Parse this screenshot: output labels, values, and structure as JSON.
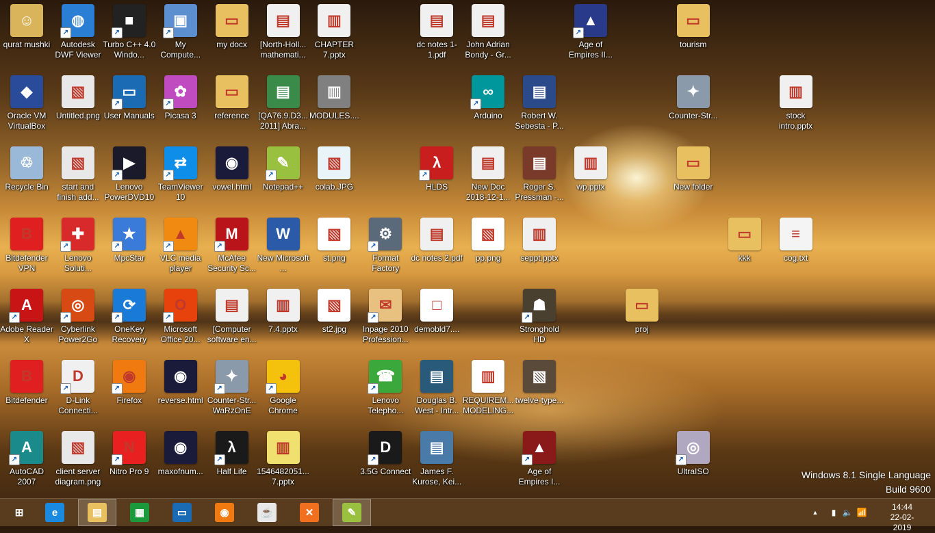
{
  "os": {
    "watermark_line1": "Windows 8.1 Single Language",
    "watermark_line2": "Build 9600"
  },
  "desktop_icons": [
    {
      "label": "qurat mushki",
      "icon": "user-folder-icon",
      "color": "#d9b45a",
      "col": 0,
      "row": 0,
      "shortcut": false
    },
    {
      "label": "Autodesk DWF Viewer",
      "icon": "globe-icon",
      "color": "#2a7fd4",
      "col": 1,
      "row": 0,
      "shortcut": true
    },
    {
      "label": "Turbo C++ 4.0 Windo...",
      "icon": "apple-icon",
      "color": "#222222",
      "col": 2,
      "row": 0,
      "shortcut": true
    },
    {
      "label": "My Compute...",
      "icon": "computer-icon",
      "color": "#5b8fd0",
      "col": 3,
      "row": 0,
      "shortcut": true
    },
    {
      "label": "my docx",
      "icon": "folder-icon",
      "color": "#e8c060",
      "col": 4,
      "row": 0,
      "shortcut": false
    },
    {
      "label": "[North-Holl... mathemati...",
      "icon": "pdf-icon",
      "color": "#f0f0f0",
      "col": 5,
      "row": 0,
      "shortcut": false
    },
    {
      "label": "CHAPTER 7.pptx",
      "icon": "pptx-icon",
      "color": "#f0f0f0",
      "col": 6,
      "row": 0,
      "shortcut": false
    },
    {
      "label": "dc notes 1-1.pdf",
      "icon": "pdf-icon",
      "color": "#f0f0f0",
      "col": 8,
      "row": 0,
      "shortcut": false
    },
    {
      "label": "John Adrian Bondy - Gr...",
      "icon": "pdf-icon",
      "color": "#f0f0f0",
      "col": 9,
      "row": 0,
      "shortcut": false
    },
    {
      "label": "Age of Empires II...",
      "icon": "helmet-icon",
      "color": "#2a3a8a",
      "col": 11,
      "row": 0,
      "shortcut": true
    },
    {
      "label": "tourism",
      "icon": "folder-icon",
      "color": "#e8c060",
      "col": 13,
      "row": 0,
      "shortcut": false
    },
    {
      "label": "Oracle VM VirtualBox",
      "icon": "cube-icon",
      "color": "#2a4a9a",
      "col": 0,
      "row": 1,
      "shortcut": false
    },
    {
      "label": "Untitled.png",
      "icon": "image-icon",
      "color": "#e8e8e8",
      "col": 1,
      "row": 1,
      "shortcut": false
    },
    {
      "label": "User Manuals",
      "icon": "lenovo-icon",
      "color": "#1a6ab4",
      "col": 2,
      "row": 1,
      "shortcut": true
    },
    {
      "label": "Picasa 3",
      "icon": "picasa-icon",
      "color": "#c04ac0",
      "col": 3,
      "row": 1,
      "shortcut": true
    },
    {
      "label": "reference",
      "icon": "folder-icon",
      "color": "#e8c060",
      "col": 4,
      "row": 1,
      "shortcut": false
    },
    {
      "label": "[QA76.9.D3... 2011] Abra...",
      "icon": "pdf-icon",
      "color": "#3a8a4a",
      "col": 5,
      "row": 1,
      "shortcut": false
    },
    {
      "label": "MODULES....",
      "icon": "pptx-icon",
      "color": "#808080",
      "col": 6,
      "row": 1,
      "shortcut": false
    },
    {
      "label": "Arduino",
      "icon": "arduino-icon",
      "color": "#00979c",
      "col": 9,
      "row": 1,
      "shortcut": true
    },
    {
      "label": "Robert W. Sebesta - P...",
      "icon": "pdf-icon",
      "color": "#2a4a8a",
      "col": 10,
      "row": 1,
      "shortcut": false
    },
    {
      "label": "Counter-Str...",
      "icon": "cs-icon",
      "color": "#8a9aaa",
      "col": 13,
      "row": 1,
      "shortcut": false
    },
    {
      "label": "stock intro.pptx",
      "icon": "pptx-icon",
      "color": "#f0f0f0",
      "col": 15,
      "row": 1,
      "shortcut": false
    },
    {
      "label": "Recycle Bin",
      "icon": "recycle-bin-icon",
      "color": "#9ab8d8",
      "col": 0,
      "row": 2,
      "shortcut": false
    },
    {
      "label": "start and finish add...",
      "icon": "image-icon",
      "color": "#e8e8e8",
      "col": 1,
      "row": 2,
      "shortcut": false
    },
    {
      "label": "Lenovo PowerDVD10",
      "icon": "play-icon",
      "color": "#1a1a2a",
      "col": 2,
      "row": 2,
      "shortcut": true
    },
    {
      "label": "TeamViewer 10",
      "icon": "teamviewer-icon",
      "color": "#0e8ee9",
      "col": 3,
      "row": 2,
      "shortcut": true
    },
    {
      "label": "vowel.html",
      "icon": "firefox-icon",
      "color": "#1a1a3a",
      "col": 4,
      "row": 2,
      "shortcut": false
    },
    {
      "label": "Notepad++",
      "icon": "notepadpp-icon",
      "color": "#9ac040",
      "col": 5,
      "row": 2,
      "shortcut": true
    },
    {
      "label": "colab.JPG",
      "icon": "image-icon",
      "color": "#e8f4f8",
      "col": 6,
      "row": 2,
      "shortcut": false
    },
    {
      "label": "HLDS",
      "icon": "halflife-icon",
      "color": "#c81e1e",
      "col": 8,
      "row": 2,
      "shortcut": true
    },
    {
      "label": "New Doc 2018-12-1...",
      "icon": "pdf-icon",
      "color": "#f0f0f0",
      "col": 9,
      "row": 2,
      "shortcut": false
    },
    {
      "label": "Roger S. Pressman -...",
      "icon": "pdf-icon",
      "color": "#7a3a2a",
      "col": 10,
      "row": 2,
      "shortcut": false
    },
    {
      "label": "wp.pptx",
      "icon": "pptx-icon",
      "color": "#f0f0f0",
      "col": 11,
      "row": 2,
      "shortcut": false
    },
    {
      "label": "New folder",
      "icon": "folder-icon",
      "color": "#e8c060",
      "col": 13,
      "row": 2,
      "shortcut": false
    },
    {
      "label": "Bitdefender VPN",
      "icon": "bitdefender-vpn-icon",
      "color": "#e02020",
      "col": 0,
      "row": 3,
      "shortcut": false
    },
    {
      "label": "Lenovo Soluti...",
      "icon": "lenovo-solutions-icon",
      "color": "#d82a2a",
      "col": 1,
      "row": 3,
      "shortcut": true
    },
    {
      "label": "MpcStar",
      "icon": "star-icon",
      "color": "#3a7ad8",
      "col": 2,
      "row": 3,
      "shortcut": true
    },
    {
      "label": "VLC media player",
      "icon": "vlc-icon",
      "color": "#f08a10",
      "col": 3,
      "row": 3,
      "shortcut": true
    },
    {
      "label": "McAfee Security Sc...",
      "icon": "mcafee-icon",
      "color": "#b8141a",
      "col": 4,
      "row": 3,
      "shortcut": true
    },
    {
      "label": "New Microsoft ...",
      "icon": "word-icon",
      "color": "#2a5aa8",
      "col": 5,
      "row": 3,
      "shortcut": false
    },
    {
      "label": "st.png",
      "icon": "image-icon",
      "color": "#ffffff",
      "col": 6,
      "row": 3,
      "shortcut": false
    },
    {
      "label": "Format Factory",
      "icon": "format-factory-icon",
      "color": "#5a6a7a",
      "col": 7,
      "row": 3,
      "shortcut": true
    },
    {
      "label": "dc notes 2.pdf",
      "icon": "pdf-icon",
      "color": "#f0f0f0",
      "col": 8,
      "row": 3,
      "shortcut": false
    },
    {
      "label": "pp.png",
      "icon": "image-icon",
      "color": "#ffffff",
      "col": 9,
      "row": 3,
      "shortcut": false
    },
    {
      "label": "seppt.pptx",
      "icon": "pptx-icon",
      "color": "#f0f0f0",
      "col": 10,
      "row": 3,
      "shortcut": false
    },
    {
      "label": "kkk",
      "icon": "folder-icon",
      "color": "#e8c060",
      "col": 14,
      "row": 3,
      "shortcut": false
    },
    {
      "label": "cog.txt",
      "icon": "text-file-icon",
      "color": "#f4f4f4",
      "col": 15,
      "row": 3,
      "shortcut": false
    },
    {
      "label": "Adobe Reader X",
      "icon": "adobe-reader-icon",
      "color": "#c81414",
      "col": 0,
      "row": 4,
      "shortcut": true
    },
    {
      "label": "Cyberlink Power2Go",
      "icon": "disc-flame-icon",
      "color": "#d84a14",
      "col": 1,
      "row": 4,
      "shortcut": true
    },
    {
      "label": "OneKey Recovery",
      "icon": "onekey-icon",
      "color": "#1a7ad8",
      "col": 2,
      "row": 4,
      "shortcut": true
    },
    {
      "label": "Microsoft Office 20...",
      "icon": "office-icon",
      "color": "#e8420c",
      "col": 3,
      "row": 4,
      "shortcut": true
    },
    {
      "label": "[Computer software en...",
      "icon": "pdf-icon",
      "color": "#f0f0f0",
      "col": 4,
      "row": 4,
      "shortcut": false
    },
    {
      "label": "7.4.pptx",
      "icon": "pptx-icon",
      "color": "#f0f0f0",
      "col": 5,
      "row": 4,
      "shortcut": false
    },
    {
      "label": "st2.jpg",
      "icon": "image-icon",
      "color": "#ffffff",
      "col": 6,
      "row": 4,
      "shortcut": false
    },
    {
      "label": "Inpage 2010 Profession...",
      "icon": "inpage-icon",
      "color": "#e8c080",
      "col": 7,
      "row": 4,
      "shortcut": true
    },
    {
      "label": "demobld7....",
      "icon": "blank-file-icon",
      "color": "#ffffff",
      "col": 8,
      "row": 4,
      "shortcut": false
    },
    {
      "label": "Stronghold HD",
      "icon": "stronghold-icon",
      "color": "#4a4030",
      "col": 10,
      "row": 4,
      "shortcut": true
    },
    {
      "label": "proj",
      "icon": "folder-icon",
      "color": "#e8c060",
      "col": 12,
      "row": 4,
      "shortcut": false
    },
    {
      "label": "Bitdefender",
      "icon": "bitdefender-icon",
      "color": "#e02020",
      "col": 0,
      "row": 5,
      "shortcut": false
    },
    {
      "label": "D-Link Connecti...",
      "icon": "dlink-icon",
      "color": "#f0f0f0",
      "col": 1,
      "row": 5,
      "shortcut": true
    },
    {
      "label": "Firefox",
      "icon": "firefox-icon",
      "color": "#f07a10",
      "col": 2,
      "row": 5,
      "shortcut": true
    },
    {
      "label": "reverse.html",
      "icon": "firefox-icon",
      "color": "#1a1a3a",
      "col": 3,
      "row": 5,
      "shortcut": false
    },
    {
      "label": "Counter-Str... WaRzOnE",
      "icon": "cs-icon",
      "color": "#8a9aaa",
      "col": 4,
      "row": 5,
      "shortcut": true
    },
    {
      "label": "Google Chrome",
      "icon": "chrome-icon",
      "color": "#f4c20d",
      "col": 5,
      "row": 5,
      "shortcut": true
    },
    {
      "label": "Lenovo Telepho...",
      "icon": "free-call-icon",
      "color": "#3aa83a",
      "col": 7,
      "row": 5,
      "shortcut": true
    },
    {
      "label": "Douglas B. West - Intr...",
      "icon": "pdf-icon",
      "color": "#2a5a7a",
      "col": 8,
      "row": 5,
      "shortcut": false
    },
    {
      "label": "REQUIREM... MODELING...",
      "icon": "pptx-icon",
      "color": "#ffffff",
      "col": 9,
      "row": 5,
      "shortcut": false
    },
    {
      "label": "twelve-type...",
      "icon": "image-icon",
      "color": "#5a4a3a",
      "col": 10,
      "row": 5,
      "shortcut": false
    },
    {
      "label": "AutoCAD 2007",
      "icon": "autocad-icon",
      "color": "#1a8a8a",
      "col": 0,
      "row": 6,
      "shortcut": true
    },
    {
      "label": "client server diagram.png",
      "icon": "image-icon",
      "color": "#e8e8e8",
      "col": 1,
      "row": 6,
      "shortcut": false
    },
    {
      "label": "Nitro Pro 9",
      "icon": "nitro-icon",
      "color": "#e82020",
      "col": 2,
      "row": 6,
      "shortcut": true
    },
    {
      "label": "maxofnum...",
      "icon": "firefox-icon",
      "color": "#1a1a3a",
      "col": 3,
      "row": 6,
      "shortcut": false
    },
    {
      "label": "Half Life",
      "icon": "halflife-icon",
      "color": "#1a1a1a",
      "col": 4,
      "row": 6,
      "shortcut": true
    },
    {
      "label": "1546482051... 7.pptx",
      "icon": "pptx-icon",
      "color": "#f0e070",
      "col": 5,
      "row": 6,
      "shortcut": false
    },
    {
      "label": "3.5G Connect",
      "icon": "dlink-icon",
      "color": "#1a1a1a",
      "col": 7,
      "row": 6,
      "shortcut": true
    },
    {
      "label": "James F. Kurose, Kei...",
      "icon": "pdf-icon",
      "color": "#4a7aa8",
      "col": 8,
      "row": 6,
      "shortcut": false
    },
    {
      "label": "Age of Empires I...",
      "icon": "helmet-icon",
      "color": "#8a1a1a",
      "col": 10,
      "row": 6,
      "shortcut": true
    },
    {
      "label": "UltraISO",
      "icon": "disc-icon",
      "color": "#b0a8c0",
      "col": 13,
      "row": 6,
      "shortcut": true
    }
  ],
  "taskbar": {
    "items": [
      {
        "name": "start-button",
        "glyph": "⊞",
        "color": "transparent",
        "active": false
      },
      {
        "name": "internet-explorer-icon",
        "glyph": "e",
        "color": "#1a8ae0",
        "active": false
      },
      {
        "name": "file-explorer-icon",
        "glyph": "▤",
        "color": "#e8c060",
        "active": true
      },
      {
        "name": "store-icon",
        "glyph": "▦",
        "color": "#1a9a3a",
        "active": false
      },
      {
        "name": "lenovo-monitor-icon",
        "glyph": "▭",
        "color": "#1a6ab4",
        "active": false
      },
      {
        "name": "firefox-icon",
        "glyph": "◉",
        "color": "#f07a10",
        "active": false
      },
      {
        "name": "java-icon",
        "glyph": "☕",
        "color": "#e8e8e8",
        "active": false
      },
      {
        "name": "xampp-icon",
        "glyph": "✕",
        "color": "#f07020",
        "active": false
      },
      {
        "name": "notepadpp-icon",
        "glyph": "✎",
        "color": "#9ac040",
        "active": true
      }
    ],
    "tray": {
      "chevron": "▲",
      "battery": "▮",
      "volume": "🔈",
      "network": "📶",
      "time": "14:44",
      "date": "22-02-2019"
    }
  }
}
